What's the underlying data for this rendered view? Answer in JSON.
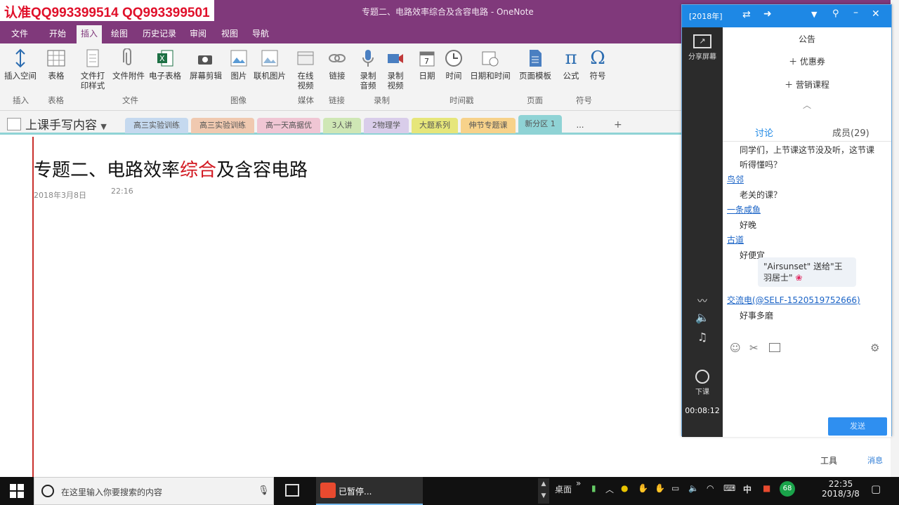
{
  "watermark": "认准QQ993399514  QQ993399501",
  "window_title": "专题二、电路效率综合及含容电路 - OneNote",
  "menu_tabs": [
    "文件",
    "开始",
    "插入",
    "绘图",
    "历史记录",
    "审阅",
    "视图",
    "导航"
  ],
  "ribbon": {
    "buttons": [
      {
        "label": "插入空间",
        "icon": "insert-space-icon"
      },
      {
        "label": "表格",
        "icon": "table-icon"
      },
      {
        "label": "文件打印样式",
        "icon": "file-printout-icon"
      },
      {
        "label": "文件附件",
        "icon": "attachment-icon"
      },
      {
        "label": "电子表格",
        "icon": "excel-icon"
      },
      {
        "label": "屏幕剪辑",
        "icon": "screen-clip-icon"
      },
      {
        "label": "图片",
        "icon": "picture-icon"
      },
      {
        "label": "联机图片",
        "icon": "online-picture-icon"
      },
      {
        "label": "在线视频",
        "icon": "online-video-icon"
      },
      {
        "label": "链接",
        "icon": "link-icon"
      },
      {
        "label": "录制音频",
        "icon": "mic-icon"
      },
      {
        "label": "录制视频",
        "icon": "video-record-icon"
      },
      {
        "label": "日期",
        "icon": "calendar-icon"
      },
      {
        "label": "时间",
        "icon": "clock-icon"
      },
      {
        "label": "日期和时间",
        "icon": "date-time-icon"
      },
      {
        "label": "页面模板",
        "icon": "page-template-icon"
      },
      {
        "label": "公式",
        "icon": "pi-icon"
      },
      {
        "label": "符号",
        "icon": "omega-icon"
      }
    ],
    "groups": [
      "插入",
      "表格",
      "文件",
      "图像",
      "媒体",
      "链接",
      "录制",
      "时间戳",
      "页面",
      "符号"
    ]
  },
  "notebook": {
    "name": "上课手写内容",
    "sections": [
      "高三实验训练",
      "高三实验训练",
      "高一天高据优",
      "3人讲",
      "2物理学",
      "大题系列",
      "伸节专题课",
      "新分区 1",
      "…"
    ]
  },
  "page": {
    "title_before": "专题二、电路效率",
    "title_highlight": "综合",
    "title_after": "及含容电路",
    "date": "2018年3月8日",
    "time": "22:16"
  },
  "chat": {
    "header_label": "[2018年]",
    "sidebar": {
      "share_label": "分享屏幕",
      "stop_label": "下课",
      "timer": "00:08:12"
    },
    "announcement": "公告",
    "promos": [
      "优惠券",
      "营销课程"
    ],
    "tabs": {
      "discuss": "讨论",
      "members": "成员(29)"
    },
    "messages": [
      {
        "type": "text",
        "text": "同学们，上节课这节没及听，这节课"
      },
      {
        "type": "text",
        "text": "听得懂吗？"
      },
      {
        "type": "user",
        "text": "鸟邻"
      },
      {
        "type": "text",
        "text": "老关的课？"
      },
      {
        "type": "user",
        "text": "一条咸鱼"
      },
      {
        "type": "text",
        "text": "好晚"
      },
      {
        "type": "user",
        "text": "古道"
      },
      {
        "type": "text",
        "text": "好便宜"
      },
      {
        "type": "gift",
        "text": "\"Airsunset\" 送给\"王羽居士\""
      },
      {
        "type": "user",
        "text": "交流电(@SELF-1520519752666)"
      },
      {
        "type": "text",
        "text": "好事多磨"
      }
    ],
    "send_label": "发送"
  },
  "bottom_tools": {
    "tools": "工具",
    "label": "消息"
  },
  "taskbar": {
    "search_placeholder": "在这里输入你要搜索的内容",
    "app_label": "已暂停...",
    "desktop_label": "桌面",
    "ime_label": "中",
    "time": "22:35",
    "date": "2018/3/8"
  }
}
